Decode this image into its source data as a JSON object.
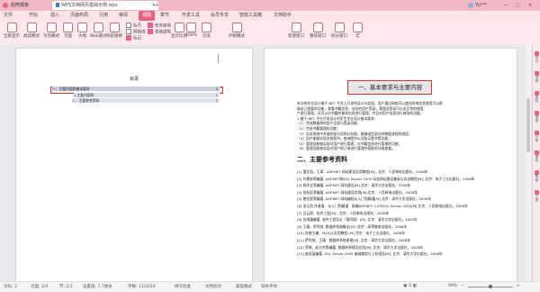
{
  "window": {
    "home_tab": "稻壳模板",
    "doc_tab": "WPS文档网页基础示例.wps",
    "add_tab": "+",
    "user": "Yu***"
  },
  "menu": {
    "items": [
      "文件",
      "开始",
      "插入",
      "页面布局",
      "引用",
      "审阅",
      "视图",
      "章节",
      "开发工具",
      "会员专享",
      "智能工具箱",
      "文档助手"
    ],
    "active_index": 6
  },
  "ribbon": {
    "buttons": [
      "全屏显示",
      "阅读模式",
      "写作模式",
      "页面",
      "大纲",
      "Web版式",
      "导航窗格",
      "显示比例",
      "100%",
      "页宽",
      "护眼模式",
      "新建窗口",
      "重排窗口",
      "拆分窗口",
      "宏"
    ],
    "checks": [
      {
        "label": "标尺",
        "on": false
      },
      {
        "label": "网格线",
        "on": false
      },
      {
        "label": "标记",
        "on": true
      },
      {
        "label": "任务窗格",
        "on": true
      },
      {
        "label": "表格虚框",
        "on": true
      }
    ],
    "view_checks": [
      "显示段落标记",
      "导航窗格"
    ]
  },
  "left_page": {
    "toc_title": "目录",
    "toc_entries": [
      {
        "text": "一、主要内容和基本要求",
        "page": "1",
        "level": 1
      },
      {
        "text": "1.主要内容和",
        "page": "1",
        "level": 2
      },
      {
        "text": "二、主要参考资料",
        "page": "1",
        "level": 2
      }
    ]
  },
  "right_page": {
    "heading1": "一、基本要求与主要内容",
    "body": [
      "本次的毕业设计基于.NET 平台上开发的设计与实现，用户通过网络可以查找系统信息使用可以屏",
      "幕自己需要的功能，查看书籍信息，对应的用户登录，管理员登录可以对正常的使用",
      "户进行管理，还可以对书籍的基本信息进行管理，并且对用户信息进行修改的功能。",
      "1.基于.NET 平台开发设计的学生学业设计基本要求：",
      "（1）完成数据库的用户注册与登录功能；",
      "（2）完成书籍管理的功能；",
      "（3）实现系统中关键的部分用例分析图，能够绑定部分的数据流程的绑定；",
      "（4）用户能够实现浏览图书，查询图书以及购买图书等功能；",
      "（5）管理员能够实现对用户进行管理，对书籍信息进行管理的功能；",
      "（6）管理员能够实现对用户的订单进行管理并获取的详细查看。"
    ],
    "heading2": "二、主要参考资料",
    "references": [
      "[1] 董文浩，王翠．ASP.NET 网站建设实用教程[M]．北京：人民邮电出版社，2008年",
      "[2] 孙素韵等编著. ASP.NET和SQL Server 2005 动态网站建设基础与实训教程[M]. 北京：电子工业出版社，2008年",
      "[3] 杨学全等编著. ASP.NET 网站建设[M].北京：清华大学出版社，2009年",
      "[4] 张跃廷等编著. ASP.NET 网站建设实例[M].北京：人民邮电出版社，2008年",
      "[5] 曾宪权等编著. ASP.NET 网站编程从入门到精通[M].北京：清华大学出版社，2009年",
      "[6] 毛元凯 作者著．从入门到精通：新编ASP.NET 2.0与SQL Server 2005[M] 北京：人民邮电出版社，2008年",
      "[7] 吕云翔．软件工程[M]．北京：人民邮电出版社，2009年",
      "[8] 张海藩编著. 软件工程导论（第四版）[M]. 北京：清华大学出版社，2003年",
      "[9] 王珊，萨师煊. 数据库系统概论[M]. 北京：高等教育出版社，2006年",
      "[10] 肖睿主编．MySQL实用教程 [M] 北京：电子工业出版社，2008年",
      "[11] 萨师煊，王珊．数据库系统原理[M]. 北京：清华大学出版社，2008年",
      "[12] 罗晓，赵方杰等编著. 数据库原理及应用[M]. 北京：清华大学出版社，2009年",
      "[13] 崔双菊编著. SQL Server 2005 基础教程与上机指导[M]. 北京：清华大学出版社，2008年"
    ]
  },
  "right_panel": [
    "样式",
    "选择",
    "属性",
    "限制",
    "分享",
    "备份",
    "帮助",
    "工具"
  ],
  "status": {
    "page": "页码: 2",
    "pages": "页面: 2/4",
    "section": "节: 2/2",
    "row": "设置值: 7.7厘米",
    "words": "字数: 11/2424",
    "spell": "拼写检查",
    "doc_check": "文档校对",
    "compat": "兼容模式",
    "missing_font": "缺失字体",
    "zoom": "99%"
  },
  "colors": {
    "accent": "#e8637f",
    "tabbar": "#f3b8c5",
    "ribbon": "#fde9ee",
    "highlight": "#e03030"
  }
}
